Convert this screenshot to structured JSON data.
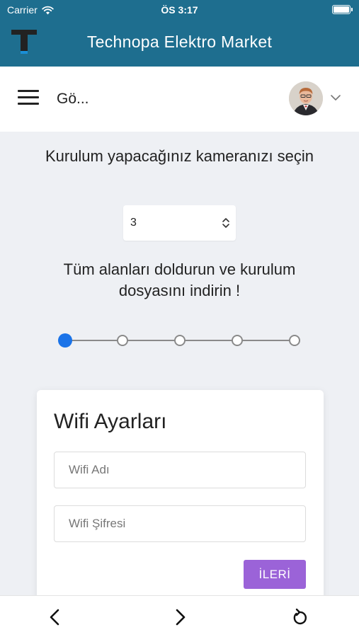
{
  "status_bar": {
    "carrier": "Carrier",
    "time": "ÖS 3:17",
    "wifi_icon": "wifi-icon",
    "battery_icon": "battery-icon",
    "battery_level": 1.0
  },
  "app_header": {
    "title": "Technopa Elektro Market",
    "logo_icon": "technopa-t-logo-icon",
    "background_color": "#1e6e8f",
    "logo_color": "#222222",
    "logo_accent_color": "#1a8fd6"
  },
  "sub_header": {
    "menu_icon": "hamburger-menu-icon",
    "title": "Gö...",
    "avatar_icon": "user-avatar",
    "chevron_icon": "chevron-down-icon"
  },
  "main": {
    "camera_prompt": "Kurulum yapacağınız kameranızı seçin",
    "camera_select": {
      "value": "3",
      "icon": "up-down-arrows-icon"
    },
    "instructions": "Tüm alanları doldurun ve kurulum dosyasını indirin !",
    "stepper": {
      "total_steps": 5,
      "current_step": 1,
      "active_color": "#1a73e8"
    }
  },
  "wifi_card": {
    "title": "Wifi Ayarları",
    "ssid_placeholder": "Wifi Adı",
    "ssid_value": "",
    "password_placeholder": "Wifi Şifresi",
    "password_value": "",
    "next_label": "İLERİ",
    "next_color": "#9b63d8"
  },
  "bottom_toolbar": {
    "back_icon": "chevron-left-icon",
    "forward_icon": "chevron-right-icon",
    "reload_icon": "reload-icon"
  }
}
